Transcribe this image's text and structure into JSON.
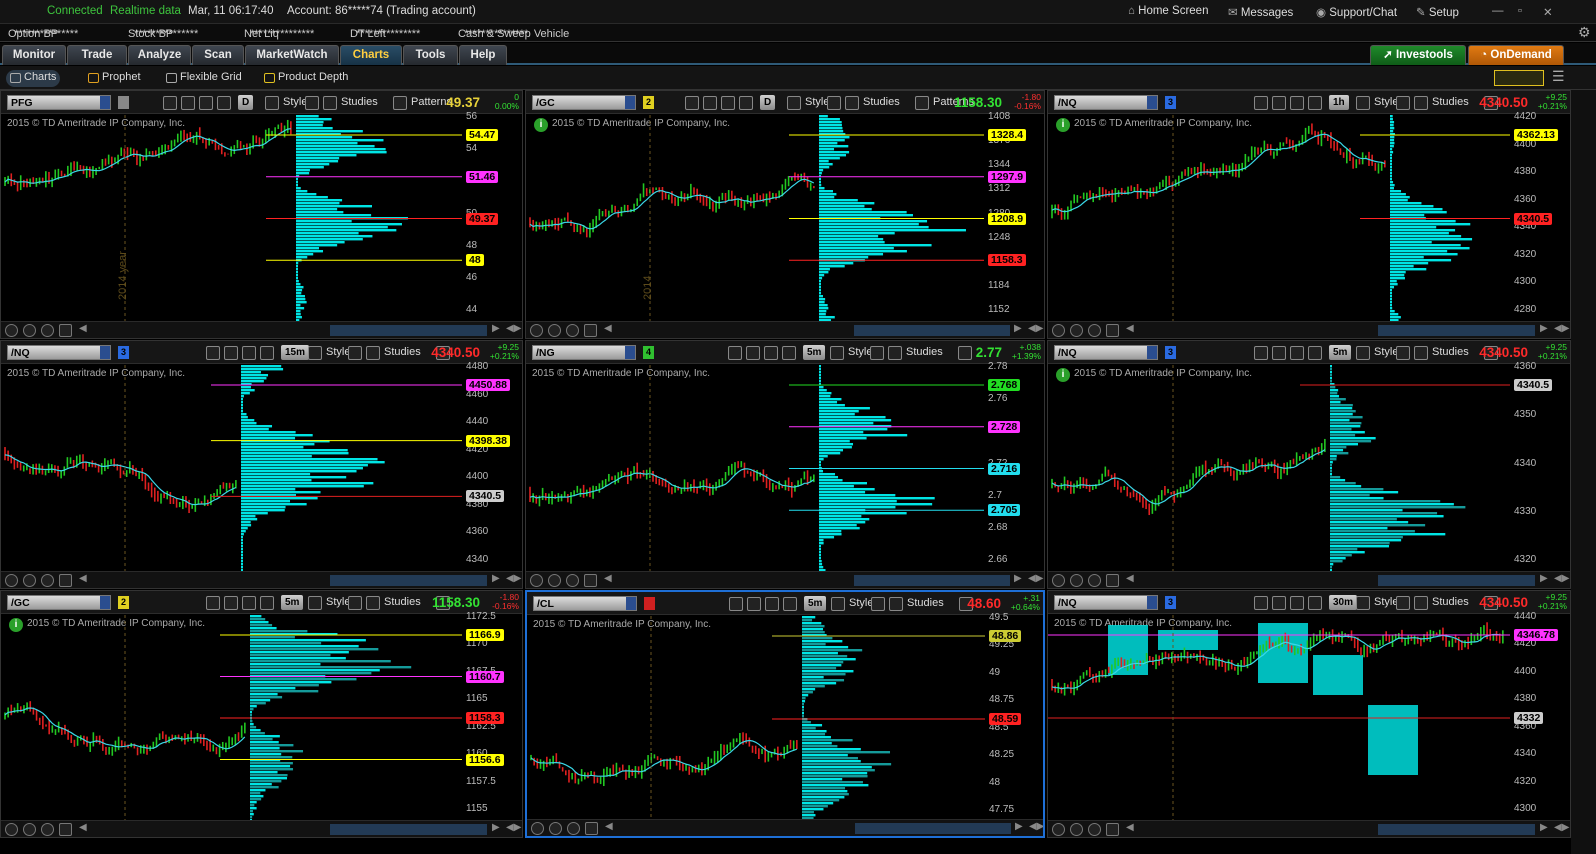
{
  "topbar": {
    "connected": "Connected",
    "realtime": "Realtime data",
    "datetime": "Mar, 11  06:17:40",
    "account": "Account: 86*****74 (Trading account)",
    "home": "Home Screen",
    "messages": "Messages",
    "support": "Support/Chat",
    "setup": "Setup"
  },
  "account_bar": [
    {
      "label": "Option BP",
      "value": "***************"
    },
    {
      "label": "Stock BP",
      "value": "***************"
    },
    {
      "label": "Net Liq",
      "value": "***************"
    },
    {
      "label": "DT Left",
      "value": "***************"
    },
    {
      "label": "Cash & Sweep Vehicle",
      "value": "***************"
    }
  ],
  "tabs": [
    "Monitor",
    "Trade",
    "Analyze",
    "Scan",
    "MarketWatch",
    "Charts",
    "Tools",
    "Help"
  ],
  "active_tab": "Charts",
  "brand_buttons": {
    "investools": "Investools",
    "ondemand": "OnDemand"
  },
  "subtabs": [
    "Charts",
    "Prophet",
    "Flexible Grid",
    "Product Depth"
  ],
  "copyright": "2015 © TD Ameritrade IP Company, Inc.",
  "style_label": "Style",
  "studies_label": "Studies",
  "patterns_label": "Patterns",
  "colors": {
    "accent": "#1e6fd6",
    "profile": "#00e5e5",
    "up": "#22c822",
    "down": "#e02020",
    "active_tab_text": "#ffcf40"
  },
  "panels": [
    {
      "symbol": "PFG",
      "link": "",
      "timeframe": "D",
      "patterns": true,
      "price": "49.37",
      "change_top": "0",
      "change_bottom": "0.00%",
      "price_color": "#e8d23a",
      "ticks": [
        "56",
        "54",
        "52",
        "50",
        "48",
        "46",
        "44"
      ],
      "badges": [
        {
          "text": "54.47",
          "color": "#ffff00"
        },
        {
          "text": "51.46",
          "color": "#ff33ff"
        },
        {
          "text": "49.37",
          "color": "#ff2222"
        },
        {
          "text": "48",
          "color": "#ffff00"
        }
      ],
      "note": "2014 year"
    },
    {
      "symbol": "/GC",
      "link": "2",
      "timeframe": "D",
      "patterns": true,
      "price": "1158.30",
      "change_top": "-1.80",
      "change_bottom": "-0.16%",
      "price_color": "#33e233",
      "ticks": [
        "1408",
        "1376",
        "1344",
        "1312",
        "1280",
        "1248",
        "1216",
        "1184",
        "1152"
      ],
      "badges": [
        {
          "text": "1328.4",
          "color": "#ffff00"
        },
        {
          "text": "1297.9",
          "color": "#ff33ff"
        },
        {
          "text": "1208.9",
          "color": "#ffff00"
        },
        {
          "text": "1158.3",
          "color": "#ff2222"
        }
      ],
      "note": "2014"
    },
    {
      "symbol": "/NQ",
      "link": "3",
      "timeframe": "1h",
      "patterns": false,
      "price": "4340.50",
      "change_top": "+9.25",
      "change_bottom": "+0.21%",
      "price_color": "#ff2a2a",
      "ticks": [
        "4420",
        "4400",
        "4380",
        "4360",
        "4340",
        "4320",
        "4300",
        "4280"
      ],
      "badges": [
        {
          "text": "4362.13",
          "color": "#ffff00"
        },
        {
          "text": "4340.5",
          "color": "#ff2222"
        }
      ],
      "note": ""
    },
    {
      "symbol": "/NQ",
      "link": "3",
      "timeframe": "15m",
      "patterns": false,
      "price": "4340.50",
      "change_top": "+9.25",
      "change_bottom": "+0.21%",
      "price_color": "#ff2a2a",
      "ticks": [
        "4480",
        "4460",
        "4440",
        "4420",
        "4400",
        "4380",
        "4360",
        "4340"
      ],
      "badges": [
        {
          "text": "4450.88",
          "color": "#ff33ff"
        },
        {
          "text": "4398.38",
          "color": "#ffff00"
        },
        {
          "text": "4340.5",
          "color": "#cccccc"
        }
      ],
      "note": ""
    },
    {
      "symbol": "/NG",
      "link": "4",
      "timeframe": "5m",
      "patterns": false,
      "price": "2.77",
      "change_top": "+.038",
      "change_bottom": "+1.39%",
      "price_color": "#33e233",
      "ticks": [
        "2.78",
        "2.76",
        "2.74",
        "2.72",
        "2.7",
        "2.68",
        "2.66"
      ],
      "badges": [
        {
          "text": "2.768",
          "color": "#22dd22"
        },
        {
          "text": "2.728",
          "color": "#ff33ff"
        },
        {
          "text": "2.716",
          "color": "#22ddee"
        },
        {
          "text": "2.705",
          "color": "#22ddee"
        }
      ],
      "note": ""
    },
    {
      "symbol": "/NQ",
      "link": "3",
      "timeframe": "5m",
      "patterns": false,
      "price": "4340.50",
      "change_top": "+9.25",
      "change_bottom": "+0.21%",
      "price_color": "#ff2a2a",
      "ticks": [
        "4360",
        "4350",
        "4340",
        "4330",
        "4320"
      ],
      "badges": [
        {
          "text": "4340.5",
          "color": "#cccccc"
        }
      ],
      "note": ""
    },
    {
      "symbol": "/GC",
      "link": "2",
      "timeframe": "5m",
      "patterns": false,
      "price": "1158.30",
      "change_top": "-1.80",
      "change_bottom": "-0.16%",
      "price_color": "#33e233",
      "ticks": [
        "1172.5",
        "1170",
        "1167.5",
        "1165",
        "1162.5",
        "1160",
        "1157.5",
        "1155"
      ],
      "badges": [
        {
          "text": "1166.9",
          "color": "#ffff00"
        },
        {
          "text": "1160.7",
          "color": "#ff33ff"
        },
        {
          "text": "1158.3",
          "color": "#ff2222"
        },
        {
          "text": "1156.6",
          "color": "#ffff00"
        }
      ],
      "note": ""
    },
    {
      "symbol": "/CL",
      "link": "",
      "timeframe": "5m",
      "patterns": false,
      "price": "48.60",
      "change_top": "+.31",
      "change_bottom": "+0.64%",
      "price_color": "#ff2a2a",
      "ticks": [
        "49.5",
        "49.25",
        "49",
        "48.75",
        "48.5",
        "48.25",
        "48",
        "47.75"
      ],
      "badges": [
        {
          "text": "48.86",
          "color": "#cccc33"
        },
        {
          "text": "48.59",
          "color": "#ff2222"
        }
      ],
      "note": ""
    },
    {
      "symbol": "/NQ",
      "link": "3",
      "timeframe": "30m",
      "patterns": false,
      "price": "4340.50",
      "change_top": "+9.25",
      "change_bottom": "+0.21%",
      "price_color": "#ff2a2a",
      "ticks": [
        "4440",
        "4420",
        "4400",
        "4380",
        "4360",
        "4340",
        "4320",
        "4300"
      ],
      "badges": [
        {
          "text": "4346.78",
          "color": "#ff33ff"
        },
        {
          "text": "4332",
          "color": "#cccccc"
        }
      ],
      "note": ""
    }
  ]
}
